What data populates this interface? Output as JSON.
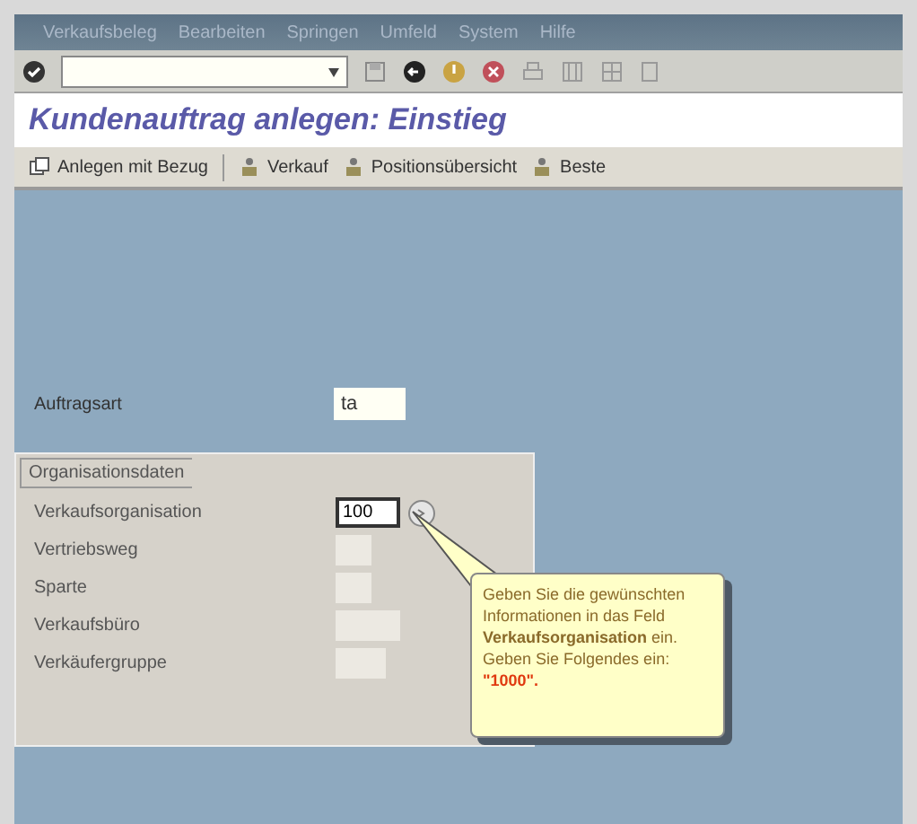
{
  "menu_bar": [
    "Verkaufsbeleg",
    "Bearbeiten",
    "Springen",
    "Umfeld",
    "System",
    "Hilfe"
  ],
  "title": "Kundenauftrag anlegen: Einstieg",
  "app_toolbar": [
    {
      "label": "Anlegen mit Bezug",
      "kind": "copy"
    },
    {
      "label": "Verkauf",
      "kind": "person"
    },
    {
      "label": "Positionsübersicht",
      "kind": "person"
    },
    {
      "label": "Beste",
      "kind": "person"
    }
  ],
  "order_type": {
    "label": "Auftragsart",
    "value": "ta"
  },
  "org_group": {
    "title": "Organisationsdaten",
    "fields": [
      {
        "label": "Verkaufsorganisation",
        "value": "100",
        "focused": true
      },
      {
        "label": "Vertriebsweg",
        "focused": false
      },
      {
        "label": "Sparte",
        "focused": false
      },
      {
        "label": "Verkaufsbüro",
        "focused": false
      },
      {
        "label": "Verkäufergruppe",
        "focused": false
      }
    ]
  },
  "tooltip": {
    "text": "Geben Sie die gewünschten Informationen in das Feld **Verkaufsorganisation** ein.",
    "instruction": "Geben Sie Folgendes ein:",
    "value": "\"1000\"."
  }
}
